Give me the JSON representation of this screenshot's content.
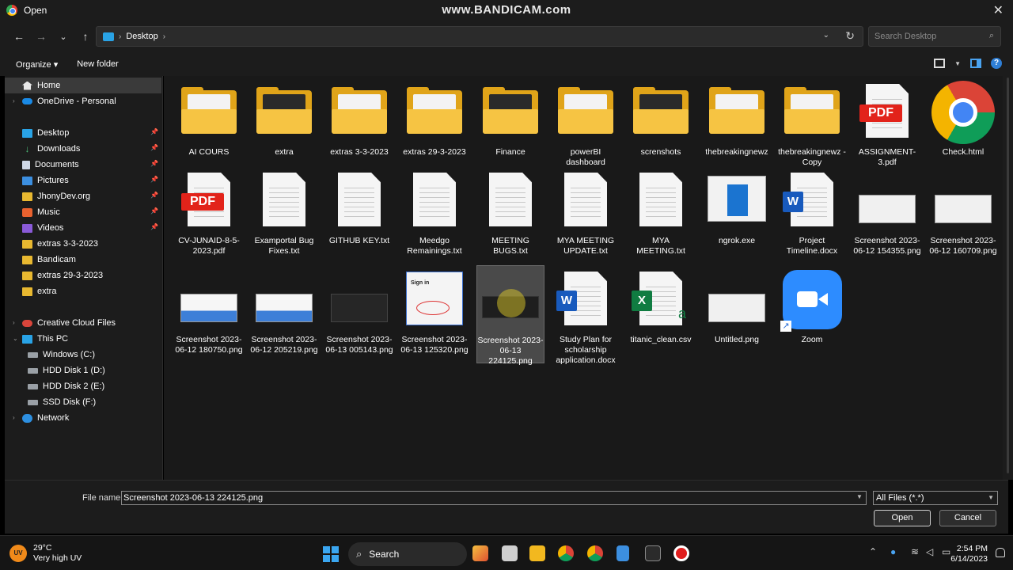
{
  "window": {
    "title": "Open",
    "watermark": "www.BANDICAM.com",
    "close_glyph": "✕"
  },
  "nav": {
    "back": "←",
    "forward": "→",
    "recent": "⌄",
    "up": "↑",
    "breadcrumb": [
      "Desktop"
    ],
    "search_placeholder": "Search Desktop"
  },
  "toolbar": {
    "organize": "Organize ▾",
    "new_folder": "New folder"
  },
  "sidebar": {
    "items": [
      {
        "label": "Home",
        "icon": "home-icon",
        "selected": true
      },
      {
        "label": "OneDrive - Personal",
        "icon": "cloud-icon"
      },
      {
        "label": "Desktop",
        "icon": "desktop-icon",
        "pinned": true
      },
      {
        "label": "Downloads",
        "icon": "download-icon",
        "pinned": true
      },
      {
        "label": "Documents",
        "icon": "document-icon",
        "pinned": true
      },
      {
        "label": "Pictures",
        "icon": "pictures-icon",
        "pinned": true
      },
      {
        "label": "JhonyDev.org",
        "icon": "folder-icon",
        "pinned": true
      },
      {
        "label": "Music",
        "icon": "music-icon",
        "pinned": true
      },
      {
        "label": "Videos",
        "icon": "videos-icon",
        "pinned": true
      },
      {
        "label": "extras 3-3-2023",
        "icon": "folder-icon"
      },
      {
        "label": "Bandicam",
        "icon": "folder-icon"
      },
      {
        "label": "extras 29-3-2023",
        "icon": "folder-icon"
      },
      {
        "label": "extra",
        "icon": "folder-icon"
      },
      {
        "label": "Creative Cloud Files",
        "icon": "creative-cloud-icon"
      },
      {
        "label": "This PC",
        "icon": "pc-icon"
      },
      {
        "label": "Windows (C:)",
        "icon": "drive-icon"
      },
      {
        "label": "HDD Disk 1 (D:)",
        "icon": "drive-icon"
      },
      {
        "label": "HDD Disk 2 (E:)",
        "icon": "drive-icon"
      },
      {
        "label": "SSD Disk (F:)",
        "icon": "drive-icon"
      },
      {
        "label": "Network",
        "icon": "network-icon"
      }
    ]
  },
  "files": [
    {
      "name": "AI COURS",
      "type": "folder"
    },
    {
      "name": "extra",
      "type": "folder-dark"
    },
    {
      "name": "extras 3-3-2023",
      "type": "folder"
    },
    {
      "name": "extras 29-3-2023",
      "type": "folder"
    },
    {
      "name": "Finance",
      "type": "folder-dark"
    },
    {
      "name": "powerBI dashboard",
      "type": "folder"
    },
    {
      "name": "screnshots",
      "type": "folder-dark"
    },
    {
      "name": "thebreakingnewz",
      "type": "folder"
    },
    {
      "name": "thebreakingnewz - Copy",
      "type": "folder"
    },
    {
      "name": "ASSIGNMENT-3.pdf",
      "type": "pdf"
    },
    {
      "name": "Check.html",
      "type": "chrome"
    },
    {
      "name": "CV-JUNAID-8-5-2023.pdf",
      "type": "pdf"
    },
    {
      "name": "Examportal Bug Fixes.txt",
      "type": "txt"
    },
    {
      "name": "GITHUB KEY.txt",
      "type": "txt"
    },
    {
      "name": "Meedgo Remainings.txt",
      "type": "txt"
    },
    {
      "name": "MEETING BUGS.txt",
      "type": "txt"
    },
    {
      "name": "MYA MEETING UPDATE.txt",
      "type": "txt"
    },
    {
      "name": "MYA MEETING.txt",
      "type": "txt"
    },
    {
      "name": "ngrok.exe",
      "type": "exe"
    },
    {
      "name": "Project Timeline.docx",
      "type": "docx"
    },
    {
      "name": "Screenshot 2023-06-12 154355.png",
      "type": "png"
    },
    {
      "name": "Screenshot 2023-06-12 160709.png",
      "type": "png"
    },
    {
      "name": "Screenshot 2023-06-12 180750.png",
      "type": "png-blue"
    },
    {
      "name": "Screenshot 2023-06-12 205219.png",
      "type": "png-blue"
    },
    {
      "name": "Screenshot 2023-06-13 005143.png",
      "type": "png-dark"
    },
    {
      "name": "Screenshot 2023-06-13 125320.png",
      "type": "png-signin",
      "badge_text": "Sign in"
    },
    {
      "name": "Screenshot 2023-06-13 224125.png",
      "type": "png-selected",
      "selected": true
    },
    {
      "name": "Study Plan for scholarship application.docx",
      "type": "docx"
    },
    {
      "name": "titanic_clean.csv",
      "type": "csv"
    },
    {
      "name": "Untitled.png",
      "type": "png"
    },
    {
      "name": "Zoom",
      "type": "zoom"
    }
  ],
  "bottom": {
    "filename_label": "File name:",
    "filename_value": "Screenshot 2023-06-13 224125.png",
    "filter": "All Files (*.*)",
    "open": "Open",
    "cancel": "Cancel"
  },
  "taskbar": {
    "weather_temp": "29°C",
    "weather_desc": "Very high UV",
    "weather_badge": "UV",
    "search": "Search",
    "time": "2:54 PM",
    "date": "6/14/2023"
  },
  "colors": {
    "accent": "#2d8cff",
    "folder": "#f6c443",
    "pdf": "#e2231a",
    "word": "#185abd",
    "excel": "#107c41"
  }
}
